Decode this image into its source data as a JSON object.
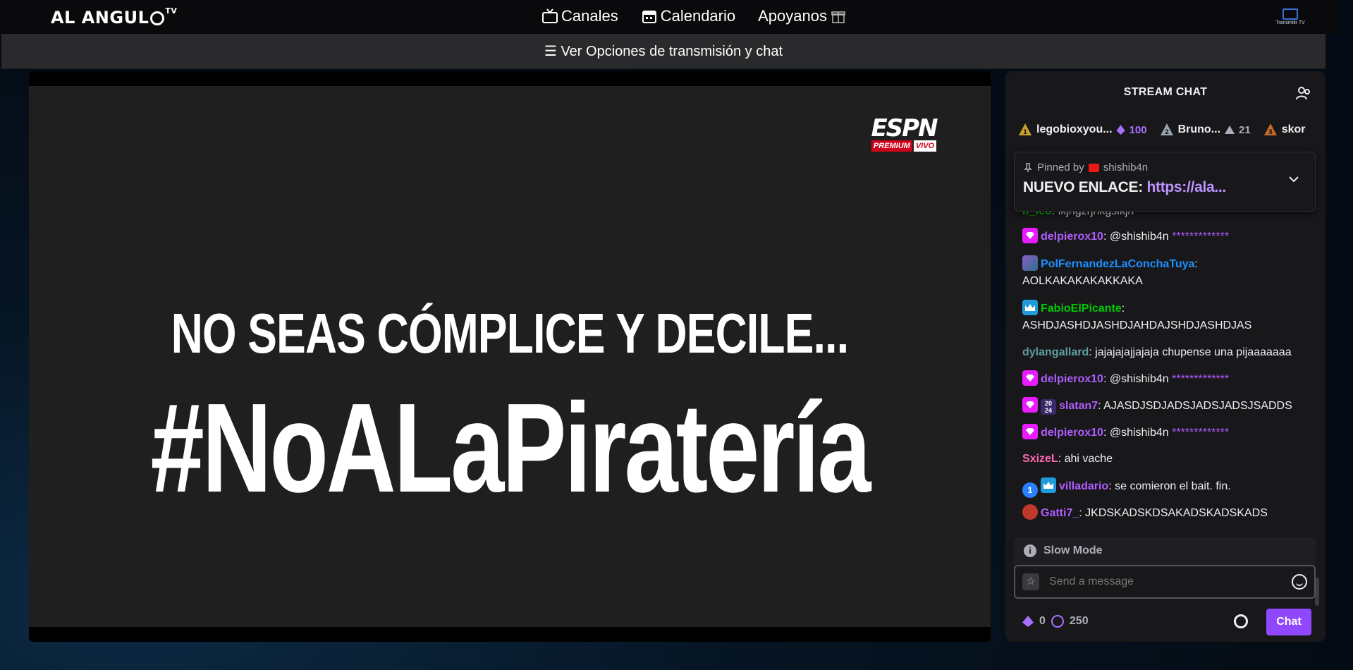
{
  "header": {
    "logo_text": "AL ANGUL",
    "logo_sup": "TV",
    "nav": [
      {
        "label": "Canales",
        "icon": "tv-icon"
      },
      {
        "label": "Calendario",
        "icon": "calendar-icon"
      },
      {
        "label": "Apoyanos",
        "icon": "gift-icon"
      }
    ],
    "cast_label": "Transmitir TV"
  },
  "options_bar": {
    "label": "☰ Ver Opciones de transmisión y chat"
  },
  "player": {
    "brand": "ESPN",
    "brand_sub": "PREMIUM",
    "brand_live": "VIVO",
    "headline": "NO SEAS CÓMPLICE Y DECILE...",
    "hashtag": "#NoALaPiratería"
  },
  "chat": {
    "title": "STREAM CHAT",
    "leaderboard": [
      {
        "rank": "1",
        "name": "legobioxyou...",
        "points": "100"
      },
      {
        "rank": "2",
        "name": "Bruno...",
        "points": "21"
      },
      {
        "rank": "3",
        "name": "skor",
        "points": ""
      }
    ],
    "pinned": {
      "pinned_by_label": "Pinned by",
      "pinned_by_user": "shishib4n",
      "message_prefix": "NUEVO ENLACE: ",
      "message_link": "https://ala..."
    },
    "messages": [
      {
        "user": "lf_leo",
        "color": "#00ff7f",
        "text": ": lkjhgzrjhkgslkjh"
      },
      {
        "user": "delpierox10",
        "color": "#b05cff",
        "text": ": @shishib4n ",
        "extra": "*************"
      },
      {
        "user": "PolFernandezLaConchaTuya",
        "color": "#1e90ff",
        "text": ":",
        "line2": "AOLKAKAKAKAKKAKA"
      },
      {
        "user": "FabioElPicante",
        "color": "#00c800",
        "text": ":",
        "line2": "ASHDJASHDJASHDJAHDAJSHDJASHDJAS"
      },
      {
        "user": "dylangallard",
        "color": "#5f9ea0",
        "text": ": jajajajajjajaja chupense una pijaaaaaaa"
      },
      {
        "user": "delpierox10",
        "color": "#b05cff",
        "text": ": @shishib4n ",
        "extra": "*************"
      },
      {
        "user": "slatan7",
        "color": "#b05cff",
        "text": ": AJASDJSDJADSJADSJADSJSADDS"
      },
      {
        "user": "delpierox10",
        "color": "#b05cff",
        "text": ": @shishib4n ",
        "extra": "*************"
      },
      {
        "user": "SxizeL",
        "color": "#ff69b4",
        "text": ": ahi vache"
      },
      {
        "user": "villadario",
        "color": "#b05cff",
        "text": ": se comieron el bait. fin."
      },
      {
        "user": "Gatti7_",
        "color": "#b05cff",
        "text": ": JKDSKADSKDSAKADSKADSKADS"
      }
    ],
    "slow_mode": "Slow Mode",
    "input_placeholder": "Send a message",
    "channel_points": "0",
    "timer": "250",
    "send_label": "Chat"
  },
  "colors": {
    "accent": "#9147ff",
    "link": "#bf94ff",
    "chat_bg": "#18181b"
  }
}
